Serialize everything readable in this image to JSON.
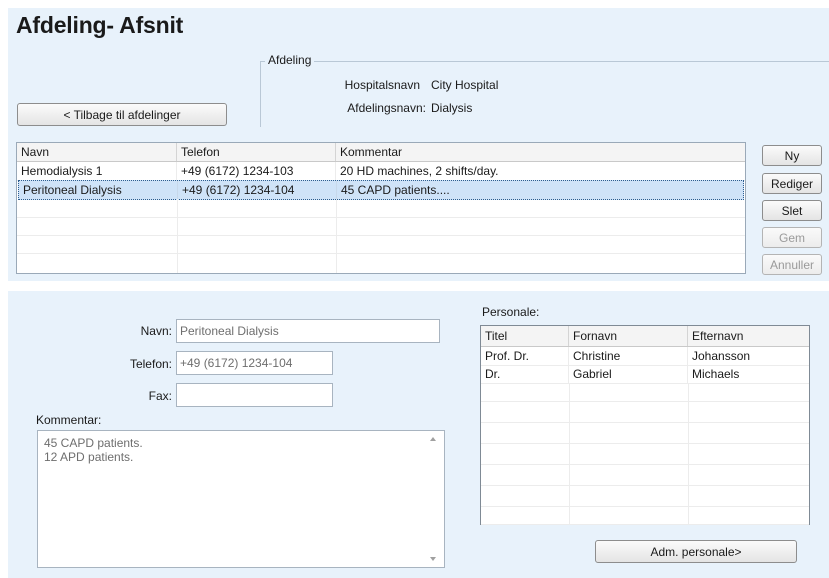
{
  "page_title": "Afdeling- Afsnit",
  "back_button": "< Tilbage til afdelinger",
  "department_group": {
    "legend": "Afdeling",
    "hospital_label": "Hospitalsnavn",
    "hospital_value": "City Hospital",
    "department_label": "Afdelingsnavn:",
    "department_value": "Dialysis"
  },
  "section_table": {
    "columns": [
      "Navn",
      "Telefon",
      "Kommentar"
    ],
    "rows": [
      [
        "Hemodialysis 1",
        "+49 (6172) 1234-103",
        "20 HD machines, 2 shifts/day."
      ],
      [
        "Peritoneal Dialysis",
        "+49 (6172) 1234-104",
        "45 CAPD patients...."
      ]
    ],
    "selected_row": 1
  },
  "side_buttons": {
    "new": "Ny",
    "edit": "Rediger",
    "delete": "Slet",
    "save": "Gem",
    "cancel": "Annuller"
  },
  "detail_form": {
    "name_label": "Navn:",
    "name_value": "Peritoneal Dialysis",
    "phone_label": "Telefon:",
    "phone_value": "+49 (6172) 1234-104",
    "fax_label": "Fax:",
    "fax_value": "",
    "comment_label": "Kommentar:",
    "comment_lines": [
      "45 CAPD patients.",
      "12 APD patients."
    ]
  },
  "staff": {
    "label": "Personale:",
    "columns": [
      "Titel",
      "Fornavn",
      "Efternavn"
    ],
    "rows": [
      [
        "Prof. Dr.",
        "Christine",
        "Johansson"
      ],
      [
        "Dr.",
        "Gabriel",
        "Michaels"
      ]
    ],
    "manage_button": "Adm. personale>"
  },
  "icons": {
    "scroll_up": "scroll-up-arrow-icon",
    "scroll_down": "scroll-down-arrow-icon"
  }
}
